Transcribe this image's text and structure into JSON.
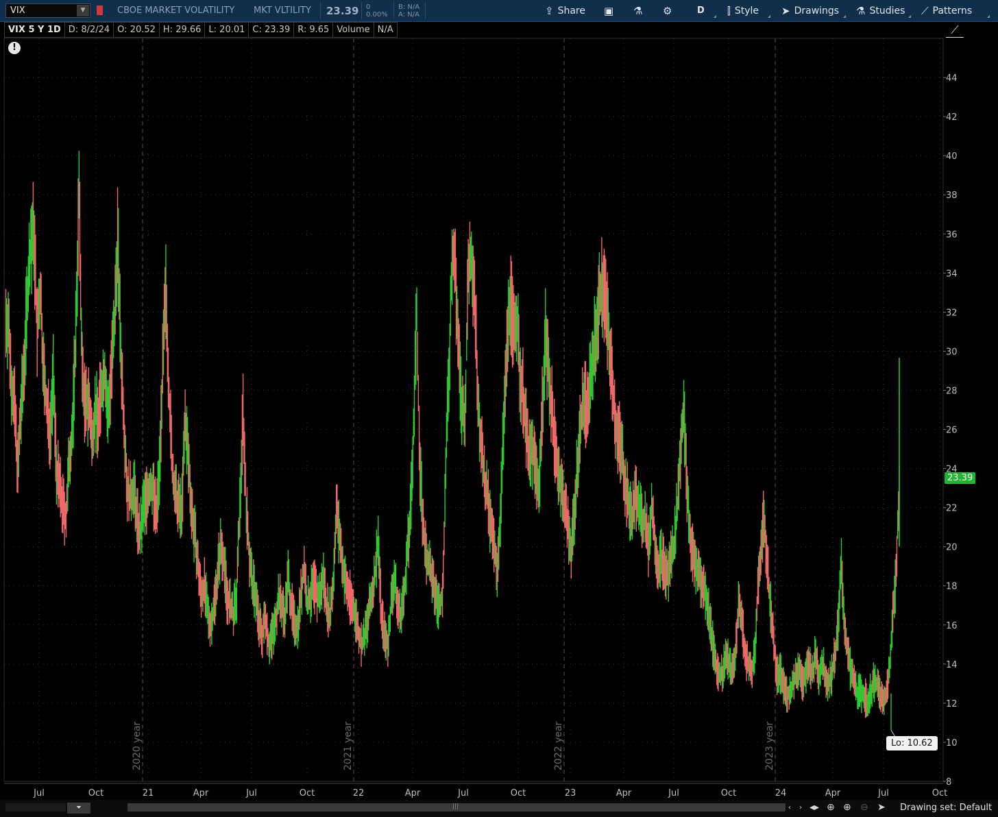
{
  "toolbar": {
    "symbol": "VIX",
    "description": "CBOE MARKET VOLATILITY",
    "short_name": "MKT VLTILITY",
    "last_price": "23.39",
    "change": "0",
    "change_pct": "0.00%",
    "bid": "B: N/A",
    "ask": "A: N/A",
    "share_label": "Share",
    "timeframe_label": "D",
    "style_label": "Style",
    "drawings_label": "Drawings",
    "studies_label": "Studies",
    "patterns_label": "Patterns"
  },
  "info_bar": {
    "period": "VIX 5 Y 1D",
    "date": "D: 8/2/24",
    "open": "O: 20.52",
    "high": "H: 29.66",
    "low": "L: 20.01",
    "close": "C: 23.39",
    "range": "R: 9.65",
    "volume_label": "Volume",
    "volume_value": "N/A"
  },
  "price_tag": "23.39",
  "low_tag": "Lo: 10.62",
  "bottom": {
    "drawing_set": "Drawing set: Default"
  },
  "icons": {
    "alert": "exclamation-icon",
    "share": "share-icon",
    "flask": "flask-icon",
    "gear": "gear-icon",
    "style": "candlestick-icon",
    "drawings": "cursor-icon",
    "studies": "flask-icon",
    "patterns": "chart-pattern-icon"
  },
  "colors": {
    "up": "#2ecc2e",
    "down": "#f06a6a",
    "background": "#000000",
    "grid": "#3a3a3a",
    "price_tag": "#1fb52f"
  },
  "chart_data": {
    "type": "line",
    "title": "",
    "ylabel": "",
    "xlabel": "",
    "ylim": [
      8,
      46
    ],
    "y_ticks": [
      8,
      10,
      12,
      14,
      16,
      18,
      20,
      22,
      24,
      26,
      28,
      30,
      32,
      34,
      36,
      38,
      40,
      42,
      44
    ],
    "x_tick_labels": [
      "Jul",
      "Oct",
      "21",
      "Apr",
      "Jul",
      "Oct",
      "22",
      "Apr",
      "Jul",
      "Oct",
      "23",
      "Apr",
      "Jul",
      "Oct",
      "24",
      "Apr",
      "Jul",
      "Oct"
    ],
    "year_markers": [
      "2020 year",
      "2021 year",
      "2022 year",
      "2023 year"
    ],
    "last_close": 23.39,
    "period_low": 10.62,
    "grid": true,
    "series": [
      {
        "values": [
          31.5,
          28.5,
          27.0,
          24.0,
          27.0,
          29.5,
          33.0,
          35.5,
          36.0,
          31.0,
          33.0,
          29.0,
          27.0,
          26.0,
          28.5,
          24.0,
          23.0,
          22.0,
          21.5,
          24.5,
          26.0,
          31.0,
          38.0,
          29.0,
          27.0,
          27.5,
          25.5,
          27.0,
          26.5,
          28.0,
          29.0,
          26.5,
          29.0,
          31.0,
          36.0,
          30.0,
          26.5,
          23.0,
          22.5,
          23.0,
          21.5,
          20.5,
          22.0,
          22.5,
          23.0,
          23.0,
          21.5,
          24.0,
          29.0,
          33.0,
          28.0,
          24.0,
          22.5,
          22.0,
          22.0,
          26.5,
          24.5,
          22.0,
          20.5,
          19.0,
          17.5,
          18.0,
          16.5,
          16.0,
          17.0,
          18.5,
          20.0,
          19.5,
          17.5,
          17.0,
          16.5,
          17.5,
          22.0,
          27.0,
          22.0,
          19.5,
          18.0,
          17.5,
          16.0,
          15.5,
          16.5,
          15.0,
          15.5,
          16.0,
          17.5,
          17.0,
          16.5,
          18.5,
          17.0,
          16.0,
          16.0,
          17.5,
          19.0,
          17.0,
          17.5,
          18.0,
          17.5,
          17.5,
          18.5,
          17.0,
          16.5,
          18.0,
          22.0,
          20.5,
          19.0,
          18.0,
          17.5,
          17.0,
          16.5,
          15.5,
          15.0,
          15.5,
          16.5,
          17.5,
          18.5,
          20.5,
          16.5,
          15.5,
          15.0,
          17.0,
          18.5,
          17.0,
          16.5,
          17.5,
          19.5,
          21.5,
          26.0,
          32.0,
          24.0,
          21.0,
          19.5,
          19.0,
          18.0,
          17.5,
          17.0,
          17.5,
          24.0,
          29.0,
          35.0,
          34.0,
          30.0,
          27.0,
          26.5,
          34.0,
          35.0,
          33.0,
          28.0,
          25.0,
          23.5,
          22.5,
          21.0,
          20.0,
          19.0,
          21.5,
          26.0,
          30.0,
          33.0,
          31.0,
          32.0,
          29.0,
          28.0,
          26.0,
          24.5,
          25.0,
          24.0,
          23.0,
          27.0,
          31.0,
          29.0,
          27.0,
          25.0,
          24.0,
          23.0,
          22.0,
          21.0,
          20.0,
          21.5,
          24.5,
          26.5,
          27.5,
          27.0,
          28.5,
          30.0,
          31.5,
          33.0,
          33.5,
          32.0,
          30.0,
          28.0,
          26.0,
          25.5,
          24.5,
          23.0,
          22.0,
          21.5,
          22.5,
          22.5,
          21.0,
          21.5,
          20.0,
          22.0,
          20.5,
          19.0,
          19.5,
          19.0,
          18.5,
          19.5,
          20.0,
          22.0,
          25.0,
          27.0,
          23.0,
          20.5,
          19.5,
          19.0,
          18.5,
          18.0,
          17.5,
          16.5,
          15.0,
          14.0,
          13.5,
          13.5,
          14.5,
          14.0,
          13.5,
          14.5,
          17.0,
          16.5,
          14.5,
          14.0,
          13.5,
          14.5,
          17.5,
          20.0,
          21.5,
          19.0,
          17.0,
          15.0,
          13.5,
          13.5,
          13.0,
          12.5,
          12.5,
          13.0,
          13.5,
          14.0,
          13.0,
          13.5,
          14.0,
          13.5,
          14.5,
          13.5,
          14.0,
          13.5,
          13.0,
          13.5,
          14.5,
          16.0,
          19.0,
          16.0,
          14.5,
          13.5,
          13.0,
          12.5,
          12.5,
          12.5,
          12.0,
          12.5,
          13.0,
          13.0,
          12.5,
          12.0,
          12.5,
          14.0,
          16.5,
          18.5,
          23.39
        ]
      }
    ]
  }
}
